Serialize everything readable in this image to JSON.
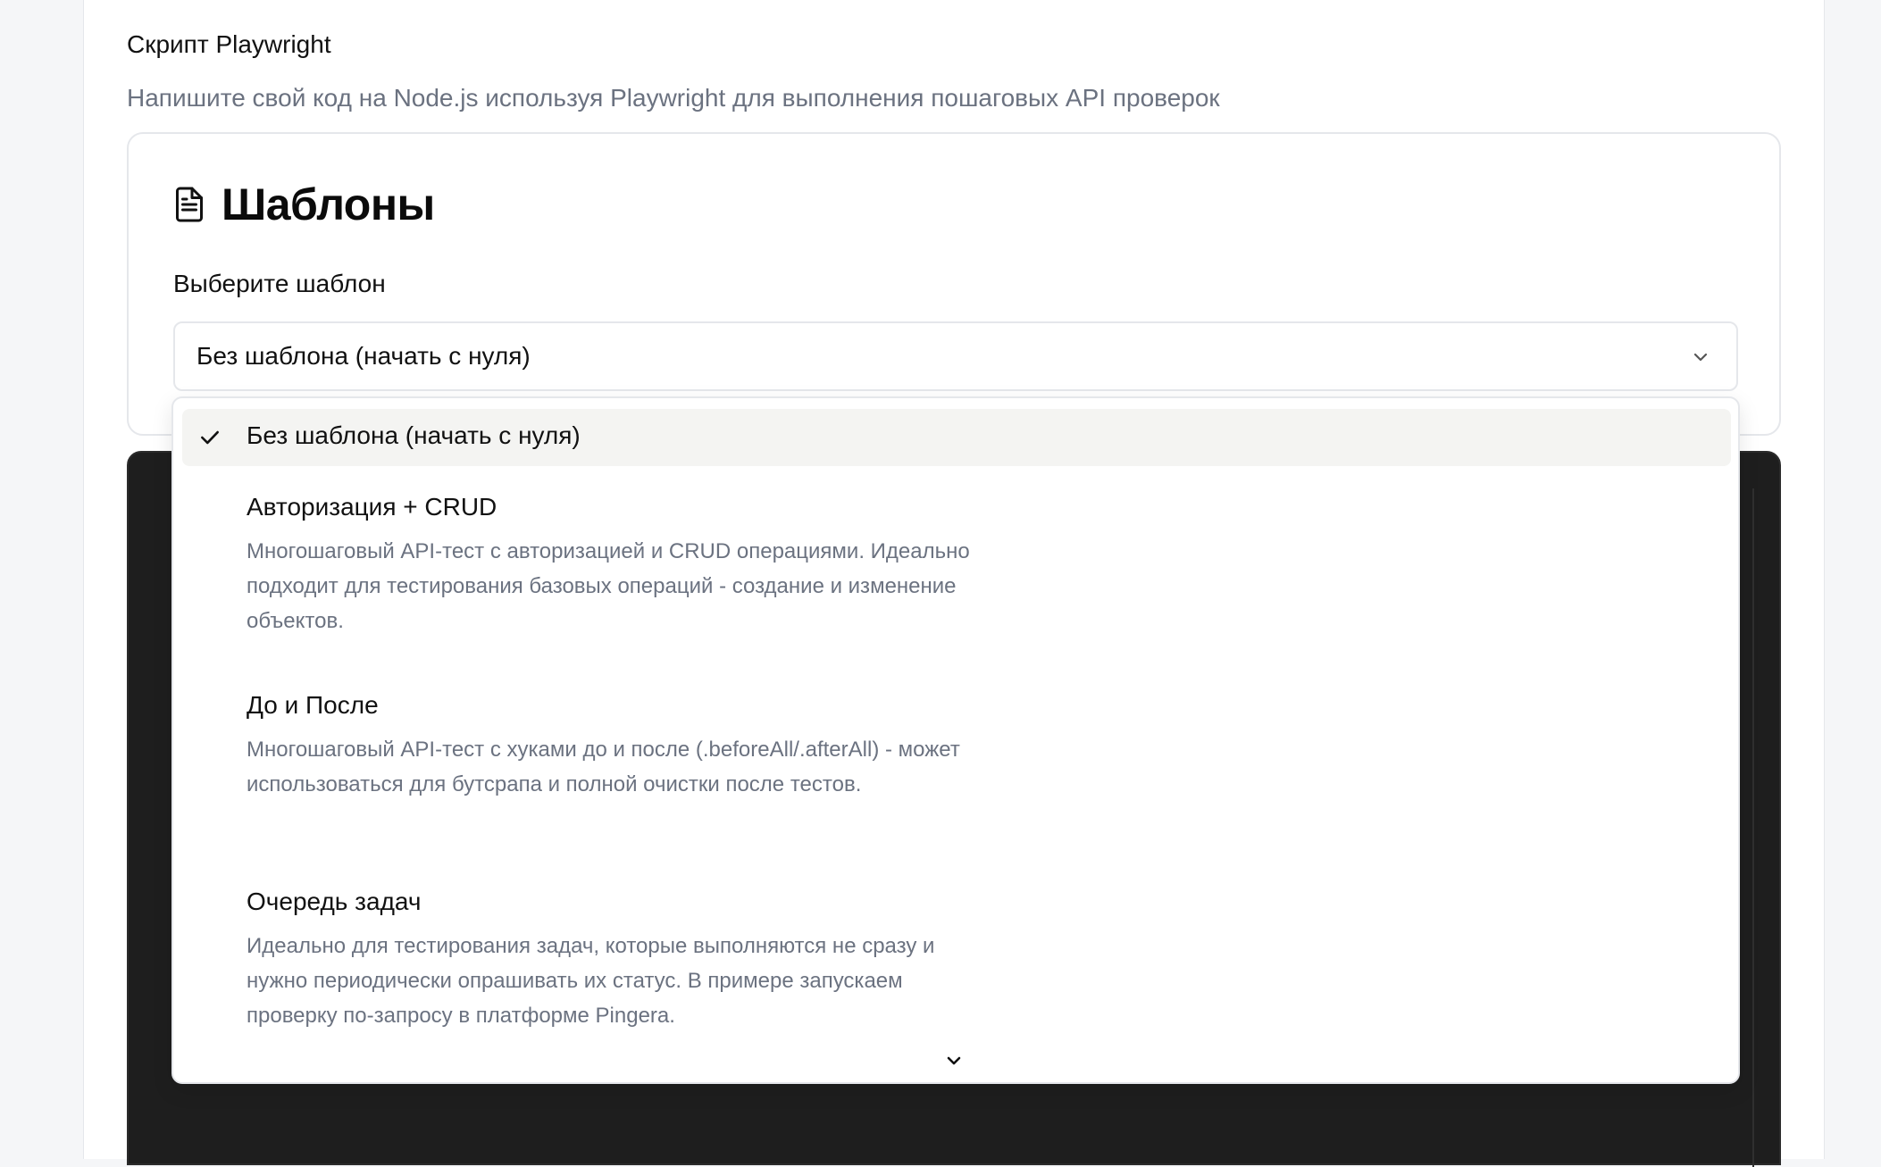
{
  "section": {
    "title": "Скрипт Playwright",
    "description": "Напишите свой код на Node.js используя Playwright для выполнения пошаговых API проверок"
  },
  "templates": {
    "title": "Шаблоны",
    "title_icon": "document-icon",
    "select_label": "Выберите шаблон",
    "selected_value": "Без шаблона (начать с нуля)"
  },
  "dropdown": {
    "selected_option": "Без шаблона (начать с нуля)",
    "options": [
      {
        "title": "Авторизация + CRUD",
        "description": "Многошаговый API-тест с авторизацией и CRUD операциями. Идеально подходит для тестирования базовых операций - создание и изменение объектов."
      },
      {
        "title": "До и После",
        "description": "Многошаговый API-тест с хуками до и после (.beforeAll/.afterAll) - может использоваться для бутсрапа и полной очистки после тестов."
      },
      {
        "title": "Очередь задач",
        "description": "Идеально для тестирования задач, которые выполняются не сразу и нужно периодически опрашивать их статус. В примере запускаем проверку по-запросу в платформе Pingera."
      }
    ]
  },
  "colors": {
    "editor_bg": "#1e1e1e",
    "selected_bg": "#f4f4f2",
    "muted_text": "#6b7280",
    "border": "#e5e7eb"
  }
}
